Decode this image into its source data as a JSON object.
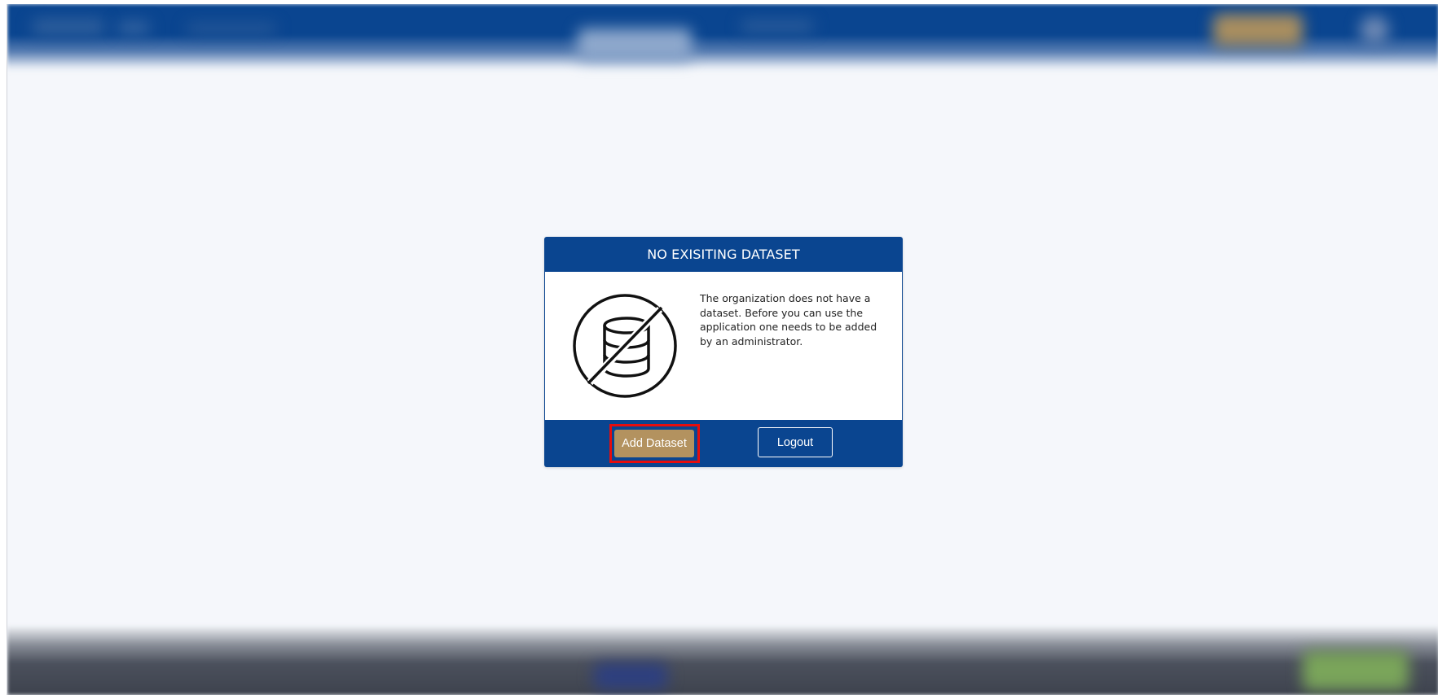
{
  "modal": {
    "title": "NO EXISITING DATASET",
    "message": "The organization does not have a dataset. Before you can use the application one needs to be added by an administrator.",
    "icon": "database-disabled-icon",
    "primary_button": "Add Dataset",
    "secondary_button": "Logout"
  },
  "colors": {
    "brand_blue": "#0a4590",
    "primary_button": "#b3925f",
    "highlight": "#e60d0d",
    "page_background": "#f5f7fb"
  }
}
